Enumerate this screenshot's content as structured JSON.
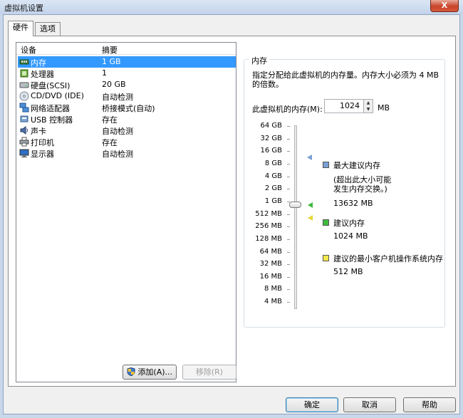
{
  "window": {
    "title": "虚拟机设置",
    "close_glyph": "X"
  },
  "tabs": [
    {
      "label": "硬件"
    },
    {
      "label": "选项"
    }
  ],
  "device_list": {
    "columns": {
      "device": "设备",
      "summary": "摘要"
    },
    "rows": [
      {
        "name": "内存",
        "summary": "1 GB",
        "icon": "memory-icon",
        "selected": true
      },
      {
        "name": "处理器",
        "summary": "1",
        "icon": "processor-icon"
      },
      {
        "name": "硬盘(SCSI)",
        "summary": "20 GB",
        "icon": "hard-disk-icon"
      },
      {
        "name": "CD/DVD (IDE)",
        "summary": "自动检测",
        "icon": "cd-dvd-icon"
      },
      {
        "name": "网络适配器",
        "summary": "桥接模式(自动)",
        "icon": "network-adapter-icon"
      },
      {
        "name": "USB 控制器",
        "summary": "存在",
        "icon": "usb-controller-icon"
      },
      {
        "name": "声卡",
        "summary": "自动检测",
        "icon": "sound-card-icon"
      },
      {
        "name": "打印机",
        "summary": "存在",
        "icon": "printer-icon"
      },
      {
        "name": "显示器",
        "summary": "自动检测",
        "icon": "display-icon"
      }
    ]
  },
  "list_buttons": {
    "add": "添加(A)...",
    "remove": "移除(R)"
  },
  "memory": {
    "group_title": "内存",
    "description_line1": "指定分配给此虚拟机的内存量。内存大小必须为 4 MB",
    "description_line2": "的倍数。",
    "field_label": "此虚拟机的内存(M):",
    "value": "1024",
    "unit": "MB",
    "scale": [
      "64 GB",
      "32 GB",
      "16 GB",
      "8 GB",
      "4 GB",
      "2 GB",
      "1 GB",
      "512 MB",
      "256 MB",
      "128 MB",
      "64 MB",
      "32 MB",
      "16 MB",
      "8 MB",
      "4 MB"
    ],
    "legend": {
      "max": {
        "title": "最大建议内存",
        "note_line1": "(超出此大小可能",
        "note_line2": "发生内存交换。)",
        "value": "13632 MB",
        "color": "#7a9fd6"
      },
      "recommended": {
        "title": "建议内存",
        "value": "1024 MB",
        "color": "#3dbb3d"
      },
      "min": {
        "title": "建议的最小客户机操作系统内存",
        "value": "512 MB",
        "color": "#f2e84a"
      }
    }
  },
  "footer_buttons": {
    "ok": "确定",
    "cancel": "取消",
    "help": "帮助"
  }
}
